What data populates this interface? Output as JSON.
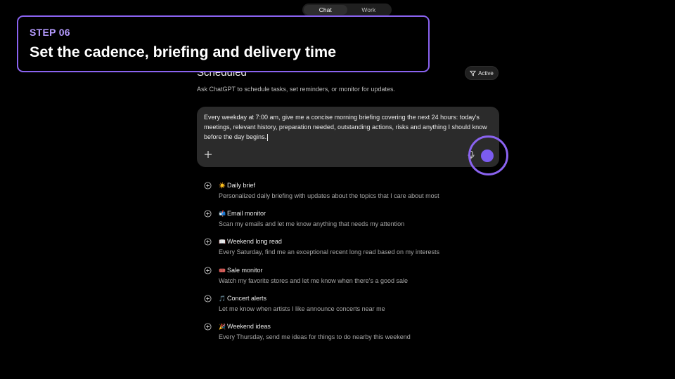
{
  "tabs": [
    {
      "label": "Chat",
      "active": true
    },
    {
      "label": "Work",
      "active": false
    }
  ],
  "step": {
    "number": "STEP 06",
    "title": "Set the cadence, briefing and delivery time",
    "accent_color": "#8a63f0"
  },
  "page": {
    "title": "Scheduled",
    "subtitle": "Ask ChatGPT to schedule tasks, set reminders, or monitor for updates.",
    "filter_label": "Active"
  },
  "composer": {
    "text": "Every weekday at 7:00 am, give me a concise morning briefing covering the next 24 hours: today's meetings, relevant history, preparation needed, outstanding actions, risks and anything I should know before the day begins.",
    "send_color": "#7b5cf0"
  },
  "suggestions": [
    {
      "icon": "sun-emoji",
      "emoji": "☀️",
      "title": "Daily brief",
      "description": "Personalized daily briefing with updates about the topics that I care about most"
    },
    {
      "icon": "inbox-emoji",
      "emoji": "📬",
      "title": "Email monitor",
      "description": "Scan my emails and let me know anything that needs my attention"
    },
    {
      "icon": "book-emoji",
      "emoji": "📖",
      "title": "Weekend long read",
      "description": "Every Saturday, find me an exceptional recent long read based on my interests"
    },
    {
      "icon": "ticket-emoji",
      "emoji": "🎟️",
      "title": "Sale monitor",
      "description": "Watch my favorite stores and let me know when there's a good sale"
    },
    {
      "icon": "music-note-emoji",
      "emoji": "🎵",
      "title": "Concert alerts",
      "description": "Let me know when artists I like announce concerts near me"
    },
    {
      "icon": "party-emoji",
      "emoji": "🎉",
      "title": "Weekend ideas",
      "description": "Every Thursday, send me ideas for things to do nearby this weekend"
    }
  ]
}
